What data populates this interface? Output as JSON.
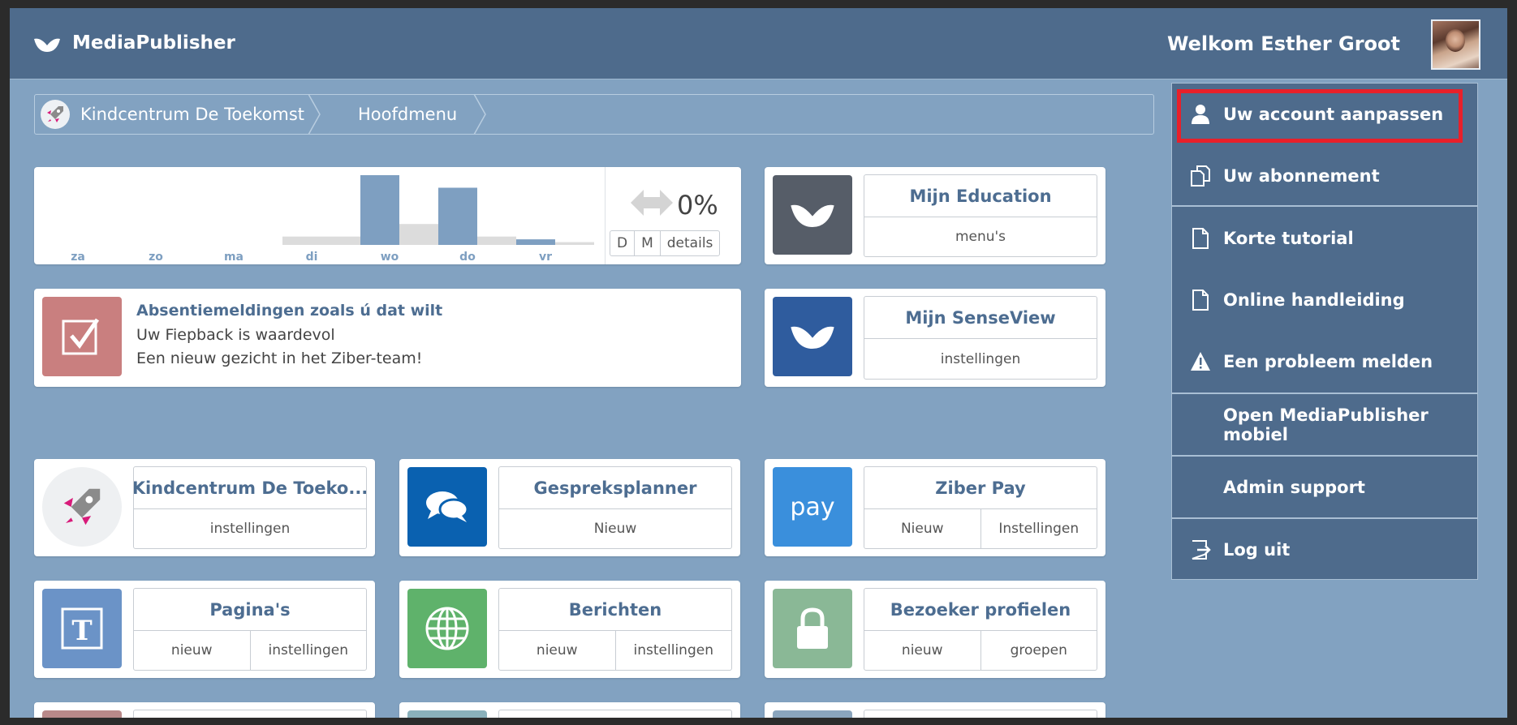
{
  "header": {
    "app_name": "MediaPublisher",
    "welcome": "Welkom Esther Groot"
  },
  "breadcrumb": {
    "items": [
      "Kindcentrum De Toekomst",
      "Hoofdmenu"
    ]
  },
  "stats": {
    "percent": "0%",
    "buttons": [
      "D",
      "M",
      "details"
    ]
  },
  "chart_data": {
    "type": "bar",
    "categories": [
      "za",
      "zo",
      "ma",
      "di",
      "wo",
      "do",
      "vr"
    ],
    "series": [
      {
        "values": [
          0,
          0,
          0,
          0,
          0,
          0,
          0
        ]
      },
      {
        "values": [
          0,
          0,
          0,
          0.12,
          0.3,
          0.12,
          0.04
        ]
      },
      {
        "values": [
          0,
          0,
          0,
          0,
          1.0,
          0.82,
          0.08
        ]
      }
    ],
    "ylim": [
      0,
      1
    ],
    "grid": false,
    "colors": {
      "light": "#dcdcdc",
      "main": "#7e9fc1"
    }
  },
  "news": {
    "title": "Absentiemeldingen zoals ú dat wilt",
    "line2": "Uw Fiepback is waardevol",
    "line3": "Een nieuw gezicht in het Ziber-team!"
  },
  "cards": {
    "education": {
      "title": "Mijn Education",
      "actions": [
        "menu's"
      ]
    },
    "senseview": {
      "title": "Mijn SenseView",
      "actions": [
        "instellingen"
      ]
    },
    "kindcentrum": {
      "title": "Kindcentrum De Toeko...",
      "actions": [
        "instellingen"
      ]
    },
    "gespreksplanner": {
      "title": "Gespreksplanner",
      "actions": [
        "Nieuw"
      ]
    },
    "ziberpay": {
      "title": "Ziber Pay",
      "actions": [
        "Nieuw",
        "Instellingen"
      ],
      "tile_text": "pay"
    },
    "paginas": {
      "title": "Pagina's",
      "actions": [
        "nieuw",
        "instellingen"
      ]
    },
    "berichten": {
      "title": "Berichten",
      "actions": [
        "nieuw",
        "instellingen"
      ]
    },
    "bezoeker": {
      "title": "Bezoeker profielen",
      "actions": [
        "nieuw",
        "groepen"
      ]
    }
  },
  "user_menu": {
    "items": [
      {
        "label": "Uw account aanpassen",
        "icon": "user-icon"
      },
      {
        "label": "Uw abonnement",
        "icon": "copy-icon"
      },
      {
        "label": "Korte tutorial",
        "icon": "document-icon"
      },
      {
        "label": "Online handleiding",
        "icon": "document-icon"
      },
      {
        "label": "Een probleem melden",
        "icon": "warning-icon"
      },
      {
        "label": "Open MediaPublisher mobiel",
        "icon": ""
      },
      {
        "label": "Admin support",
        "icon": ""
      },
      {
        "label": "Log uit",
        "icon": "logout-icon"
      }
    ]
  },
  "colors": {
    "header": "#4e6b8c",
    "background": "#82a2c1",
    "highlight": "#e8202a",
    "accent_text": "#4d6d91"
  }
}
